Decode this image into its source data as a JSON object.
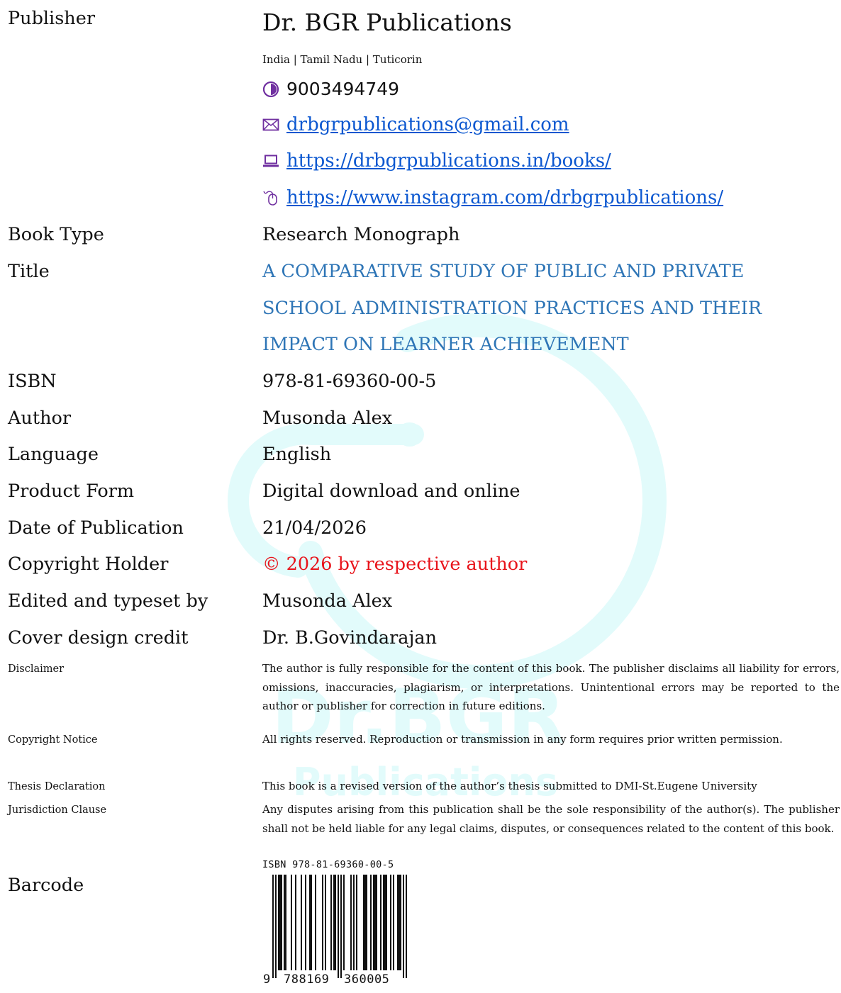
{
  "publisher": {
    "label": "Publisher",
    "name": "Dr. BGR Publications",
    "location": "India | Tamil Nadu | Tuticorin",
    "phone": "9003494749",
    "email": "drbgrpublications@gmail.com",
    "website": "https://drbgrpublications.in/books/",
    "instagram": "https://www.instagram.com/drbgrpublications/"
  },
  "fields": {
    "book_type": {
      "label": "Book Type",
      "value": "Research Monograph"
    },
    "title": {
      "label": "Title",
      "lines": [
        "A COMPARATIVE STUDY OF PUBLIC AND PRIVATE",
        "SCHOOL ADMINISTRATION PRACTICES AND THEIR",
        "IMPACT ON LEARNER ACHIEVEMENT"
      ]
    },
    "isbn": {
      "label": "ISBN",
      "value": "978-81-69360-00-5"
    },
    "author": {
      "label": "Author",
      "value": "Musonda Alex"
    },
    "language": {
      "label": "Language",
      "value": "English"
    },
    "product_form": {
      "label": "Product Form",
      "value": "Digital download and online"
    },
    "date": {
      "label": "Date of Publication",
      "value": "21/04/2026"
    },
    "copyright_holder": {
      "label": "Copyright Holder",
      "value": "© 2026 by respective author"
    },
    "edited": {
      "label": "Edited and typeset by",
      "value": "Musonda Alex"
    },
    "cover": {
      "label": "Cover design credit",
      "value": "Dr. B.Govindarajan"
    },
    "disclaimer": {
      "label": "Disclaimer",
      "value": "The author is fully responsible for the content of this book. The publisher disclaims all liability for errors, omissions, inaccuracies, plagiarism, or interpretations. Unintentional errors may be reported to the author or publisher for correction in future editions."
    },
    "copyright_notice": {
      "label": "Copyright Notice",
      "value": "All rights reserved. Reproduction or transmission in any form requires prior written permission."
    },
    "thesis": {
      "label": "Thesis Declaration",
      "value": "This book is a revised version of the author’s thesis submitted to DMI-St.Eugene University"
    },
    "jurisdiction": {
      "label": "Jurisdiction Clause",
      "value": "Any disputes arising from this publication shall be the sole responsibility of the author(s). The publisher shall not be held liable for any legal claims, disputes, or consequences related to the content of this book."
    },
    "barcode": {
      "label": "Barcode",
      "isbn_text": "ISBN 978-81-69360-00-5",
      "digits_first": "9",
      "digits_left": "788169",
      "digits_right": "360005"
    }
  },
  "watermark": {
    "line1": "Dr.BGR",
    "line2": "Publications"
  },
  "colors": {
    "title": "#2e75b6",
    "link": "#0b57d0",
    "copyright": "#e8141b",
    "icon": "#7030a0",
    "watermark": "#e2fbfb"
  }
}
